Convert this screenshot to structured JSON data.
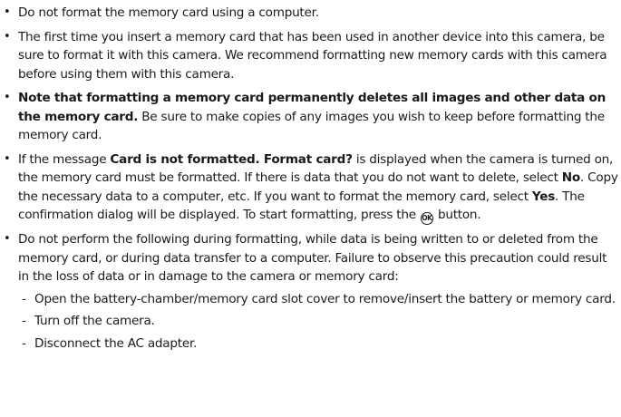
{
  "bullet_char": "•",
  "dash_char": "-",
  "items": [
    {
      "text": "Do not format the memory card using a computer."
    },
    {
      "text": "The first time you insert a memory card that has been used in another device into this camera, be sure to format it with this camera. We recommend formatting new memory cards with this camera before using them with this camera."
    },
    {
      "bold": "Note that formatting a memory card permanently deletes all images and other data on the memory card.",
      "text": " Be sure to make copies of any images you wish to keep before formatting the memory card."
    },
    {
      "p1": "If the message ",
      "b1": "Card is not formatted. Format card?",
      "p2": " is displayed when the camera is turned on, the memory card must be formatted. If there is data that you do not want to delete, select ",
      "b2": "No",
      "p3": ". Copy the necessary data to a computer, etc. If you want to format the memory card, select ",
      "b3": "Yes",
      "p4": ". The confirmation dialog will be displayed. To start formatting, press the ",
      "icon_label": "OK",
      "p5": " button."
    },
    {
      "text": "Do not perform the following during formatting, while data is being written to or deleted from the memory card, or during data transfer to a computer. Failure to observe this precaution could result in the loss of data or in damage to the camera or memory card:",
      "subitems": [
        "Open the battery-chamber/memory card slot cover to remove/insert the battery or memory card.",
        "Turn off the camera.",
        "Disconnect the AC adapter."
      ]
    }
  ]
}
